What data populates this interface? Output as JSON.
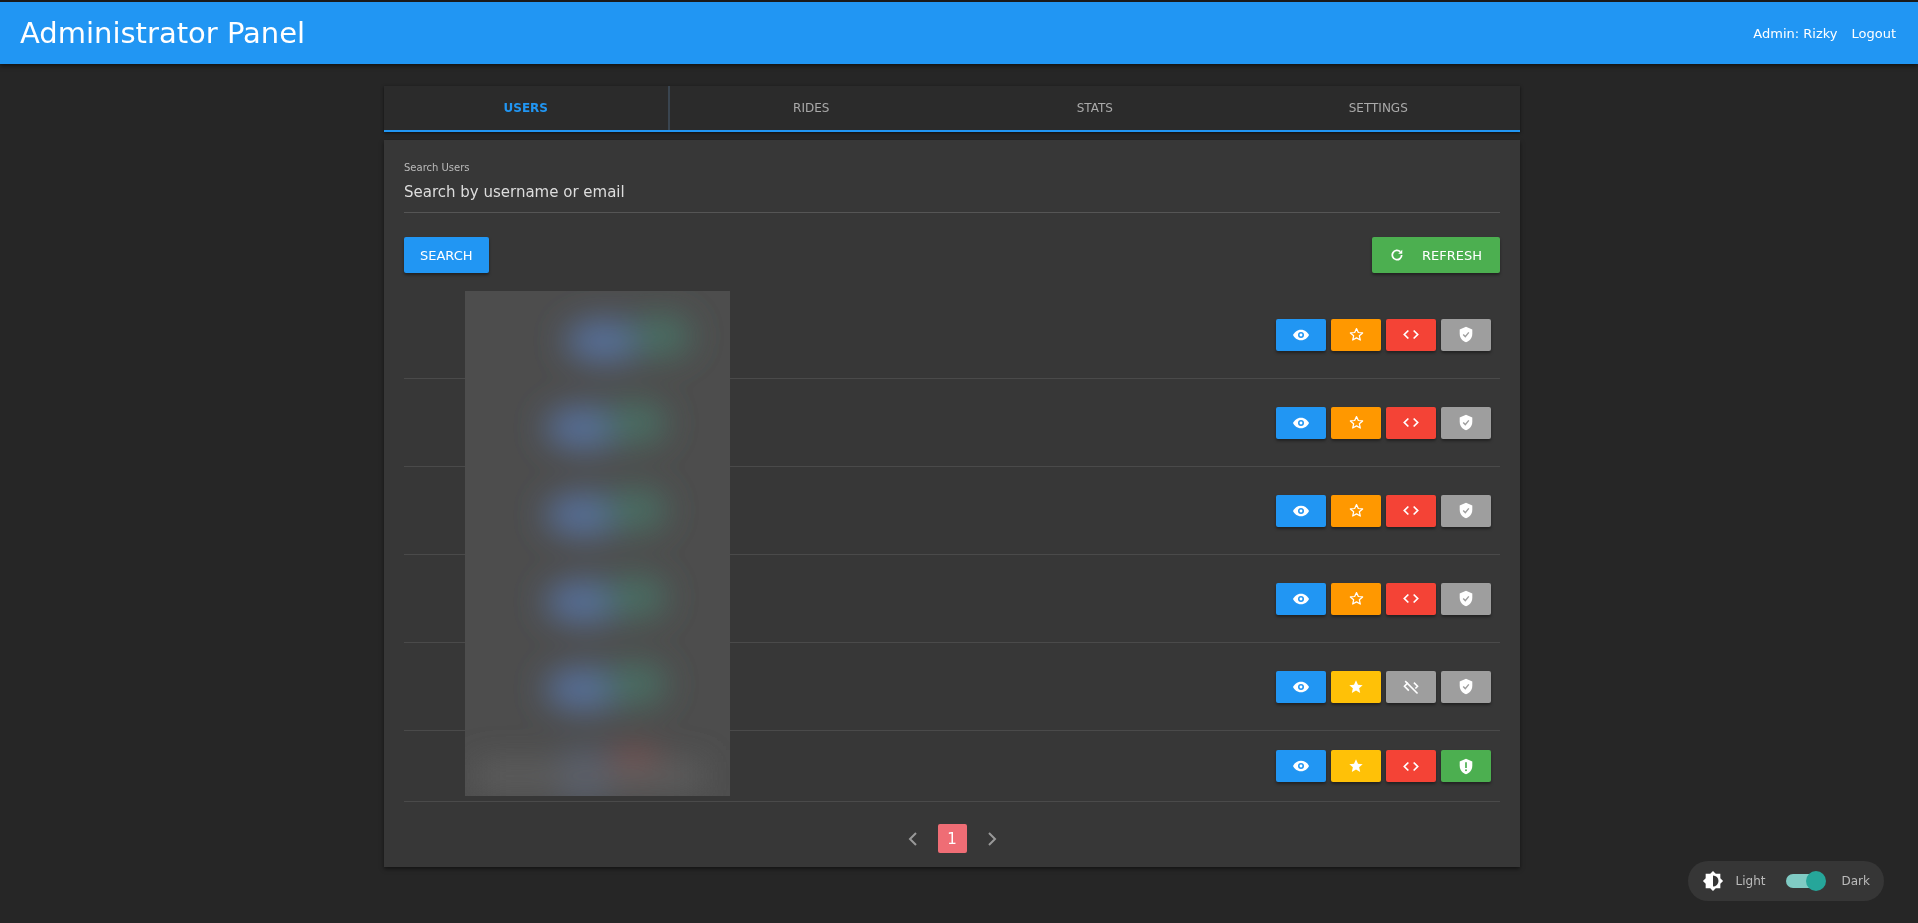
{
  "header": {
    "title": "Administrator Panel",
    "user": "Admin: Rizky",
    "logout": "Logout"
  },
  "tabs": [
    {
      "label": "USERS",
      "selected": true
    },
    {
      "label": "RIDES",
      "selected": false
    },
    {
      "label": "STATS",
      "selected": false
    },
    {
      "label": "SETTINGS",
      "selected": false
    }
  ],
  "search": {
    "label": "Search Users",
    "placeholder": "Search by username or email",
    "button": "SEARCH"
  },
  "refresh_button": "REFRESH",
  "users": {
    "kind": "picture",
    "rows": [
      {
        "starred": false,
        "code_enabled": true,
        "shield_alert": false
      },
      {
        "starred": false,
        "code_enabled": true,
        "shield_alert": false
      },
      {
        "starred": false,
        "code_enabled": true,
        "shield_alert": false
      },
      {
        "starred": false,
        "code_enabled": true,
        "shield_alert": false
      },
      {
        "starred": true,
        "code_enabled": false,
        "shield_alert": false
      },
      {
        "starred": true,
        "code_enabled": true,
        "shield_alert": true
      }
    ]
  },
  "pagination": {
    "pages": [
      {
        "label": "1",
        "selected": true
      }
    ]
  },
  "theme": {
    "light": "Light",
    "dark": "Dark",
    "on": true
  }
}
